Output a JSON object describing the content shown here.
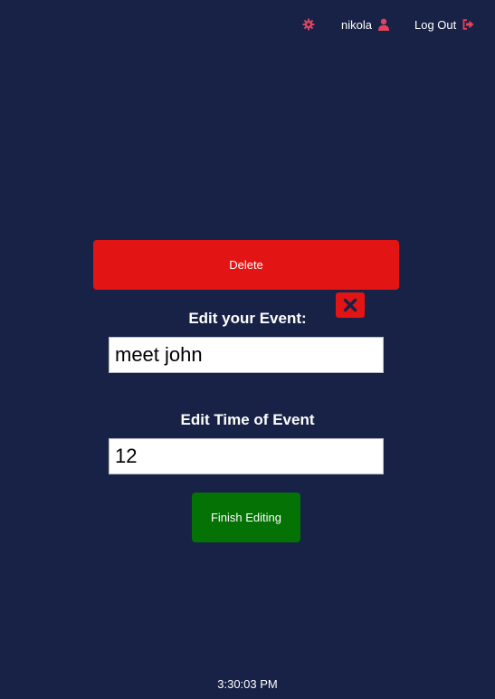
{
  "nav": {
    "settings_icon": "gear-icon",
    "username": "nikola",
    "user_icon": "user-icon",
    "logout_label": "Log Out",
    "logout_icon": "sign-out-icon",
    "accent_color": "#e0435e"
  },
  "event_form": {
    "delete_label": "Delete",
    "close_icon": "close-icon",
    "event_heading": "Edit your Event:",
    "event_value": "meet john",
    "time_heading": "Edit Time of Event",
    "time_value": "12",
    "finish_label": "Finish Editing"
  },
  "footer": {
    "clock": "3:30:03 PM"
  },
  "colors": {
    "background": "#172246",
    "delete_button": "#e31414",
    "finish_button": "#047204"
  }
}
